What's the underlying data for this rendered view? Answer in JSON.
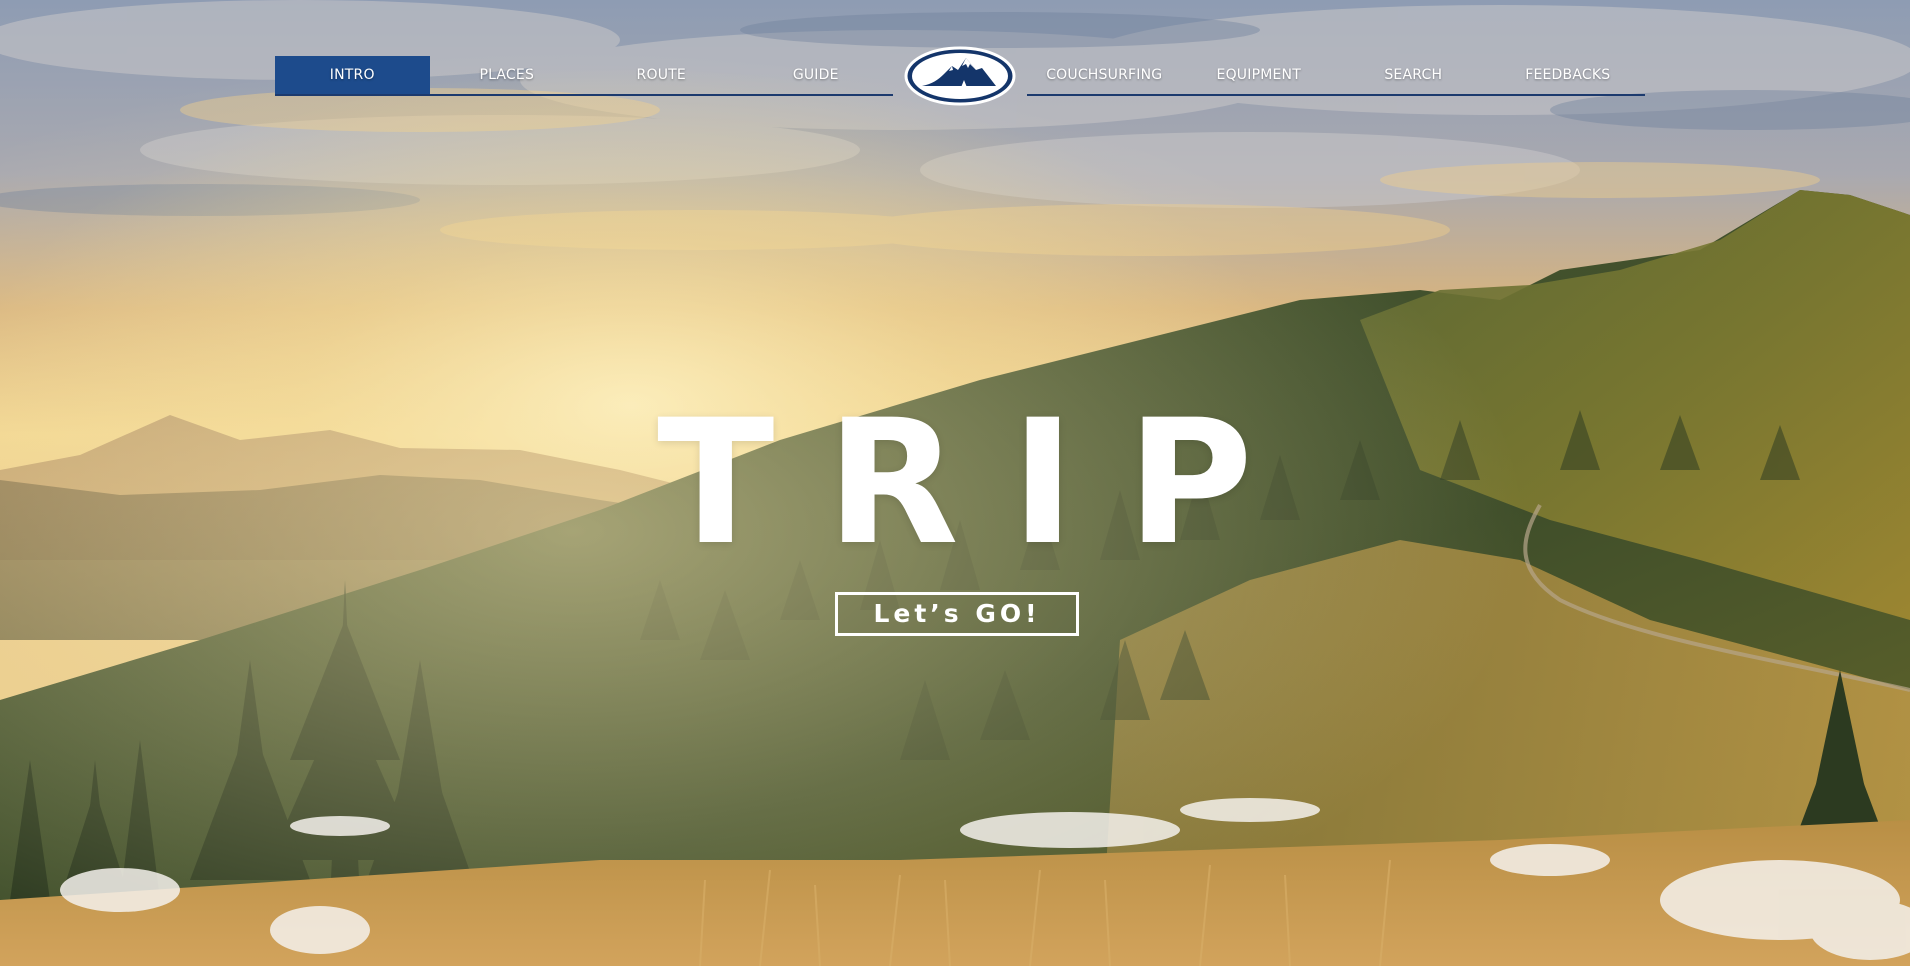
{
  "nav": {
    "left_items": [
      {
        "label": "INTRO"
      },
      {
        "label": "PLACES"
      },
      {
        "label": "ROUTE"
      },
      {
        "label": "GUIDE"
      }
    ],
    "right_items": [
      {
        "label": "COUCHSURFING"
      },
      {
        "label": "EQUIPMENT"
      },
      {
        "label": "SEARCH"
      },
      {
        "label": "FEEDBACKS"
      }
    ],
    "active": "INTRO",
    "logo_icon": "mountain-logo-icon"
  },
  "hero": {
    "title": "TRIP",
    "cta_label": "Let’s GO!"
  },
  "colors": {
    "nav_active_bg": "#1d4b8c",
    "nav_underline": "#1c3a6e",
    "logo_fill": "#14356a",
    "text": "#ffffff"
  }
}
